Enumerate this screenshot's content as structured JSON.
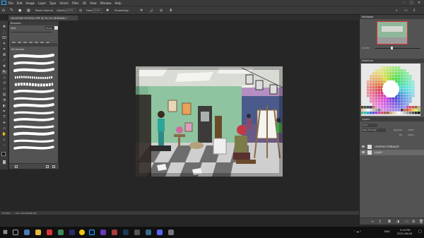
{
  "menubar": {
    "items": [
      "File",
      "Edit",
      "Image",
      "Layer",
      "Type",
      "Select",
      "Filter",
      "3D",
      "View",
      "Window",
      "Help"
    ],
    "window_controls": [
      "–",
      "□",
      "×"
    ]
  },
  "options": {
    "mode_label": "Mode:",
    "mode_value": "Normal",
    "opacity_label": "Opacity:",
    "opacity_value": "100%",
    "flow_label": "Flow:",
    "flow_value": "100%",
    "smoothing_label": "Smoothing:"
  },
  "document": {
    "tab_title": "VACATION SCHOOL.PSF @ 33.2% (RGB/8#) *"
  },
  "brushes": {
    "title": "Brushes",
    "size_label": "Size:",
    "size_value": "15 px",
    "folder_label": "My brushes"
  },
  "navigator": {
    "title": "Navigator",
    "zoom": "33.33%"
  },
  "swatches": {
    "title": "Swatches",
    "colors": [
      "#e84b3c",
      "#f08a3e",
      "#f7c74a",
      "#e8e36a",
      "#9bd35a",
      "#4fc07a",
      "#3fbfb0",
      "#3f9fd9",
      "#4a6fd6",
      "#6a52c9",
      "#9a4fc9",
      "#c84fa8",
      "#d94f6e",
      "#b85a48",
      "#8c6b4a",
      "#c6a27e",
      "#e6c9a8",
      "#f1e2cf",
      "#ffffff",
      "#e0e0e0",
      "#bdbdbd",
      "#9a9a9a",
      "#777777",
      "#555555",
      "#333333",
      "#1a1a1a",
      "#000000",
      "#6b3a2a",
      "#3a5a2a",
      "#2a4a6a",
      "#5a2a5a",
      "#a07850"
    ]
  },
  "layers": {
    "title": "Layers",
    "kind_label": "Kind",
    "blend_mode": "Pass Through",
    "opacity_label": "Opacity:",
    "opacity_value": "100%",
    "fill_label": "Fill:",
    "fill_value": "100%",
    "items": [
      {
        "name": "Untitled Artboard"
      },
      {
        "name": "Layer"
      }
    ]
  },
  "status": {
    "zoom": "33.33%",
    "doc_size": "Doc: 26.3M/466.1M"
  },
  "taskbar": {
    "language": "ENG",
    "time": "2:19 PM",
    "date": "2021-08-08"
  },
  "colors": {
    "accent": "#31a8ff",
    "panel": "#535353",
    "chrome": "#3a3a3a",
    "canvas_bg": "#262626"
  }
}
